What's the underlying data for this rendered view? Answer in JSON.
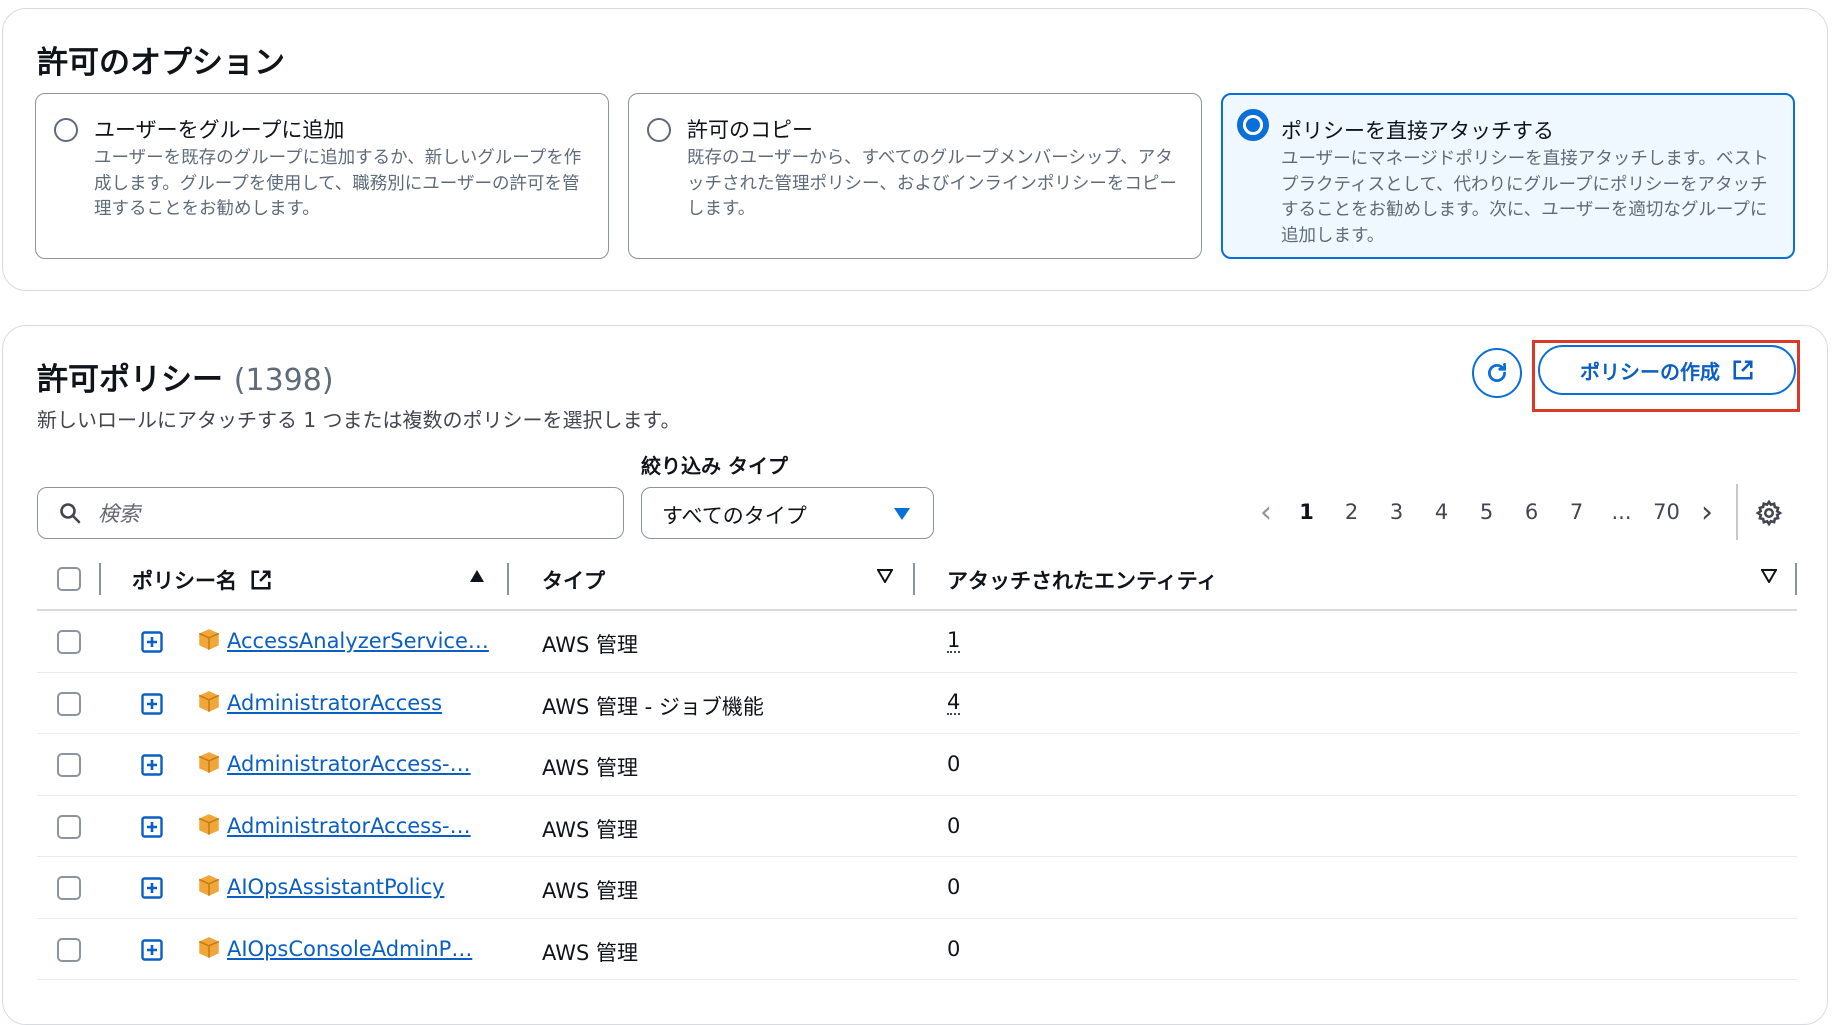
{
  "options": {
    "title": "許可のオプション",
    "cards": [
      {
        "label": "ユーザーをグループに追加",
        "desc": "ユーザーを既存のグループに追加するか、新しいグループを作成します。グループを使用して、職務別にユーザーの許可を管理することをお勧めします。",
        "selected": false
      },
      {
        "label": "許可のコピー",
        "desc": "既存のユーザーから、すべてのグループメンバーシップ、アタッチされた管理ポリシー、およびインラインポリシーをコピーします。",
        "selected": false
      },
      {
        "label": "ポリシーを直接アタッチする",
        "desc": "ユーザーにマネージドポリシーを直接アタッチします。ベストプラクティスとして、代わりにグループにポリシーをアタッチすることをお勧めします。次に、ユーザーを適切なグループに追加します。",
        "selected": true
      }
    ]
  },
  "policies": {
    "title": "許可ポリシー",
    "count": "(1398)",
    "description": "新しいロールにアタッチする 1 つまたは複数のポリシーを選択します。",
    "create_button": "ポリシーの作成",
    "filter_type_label": "絞り込み タイプ",
    "search_placeholder": "検索",
    "type_select_value": "すべてのタイプ",
    "pagination": {
      "pages": [
        "1",
        "2",
        "3",
        "4",
        "5",
        "6",
        "7",
        "...",
        "70"
      ],
      "current": "1"
    },
    "columns": {
      "name": "ポリシー名",
      "type": "タイプ",
      "entities": "アタッチされたエンティティ"
    },
    "rows": [
      {
        "name": "AccessAnalyzerService…",
        "type": "AWS 管理",
        "entities": "1"
      },
      {
        "name": "AdministratorAccess",
        "type": "AWS 管理 - ジョブ機能",
        "entities": "4"
      },
      {
        "name": "AdministratorAccess-…",
        "type": "AWS 管理",
        "entities": "0"
      },
      {
        "name": "AdministratorAccess-…",
        "type": "AWS 管理",
        "entities": "0"
      },
      {
        "name": "AIOpsAssistantPolicy",
        "type": "AWS 管理",
        "entities": "0"
      },
      {
        "name": "AIOpsConsoleAdminP…",
        "type": "AWS 管理",
        "entities": "0"
      }
    ]
  },
  "colors": {
    "accent": "#0a6fd6",
    "link": "#0a5fc4",
    "highlight": "#d93a2b",
    "aws_box": "#f0a63a"
  }
}
